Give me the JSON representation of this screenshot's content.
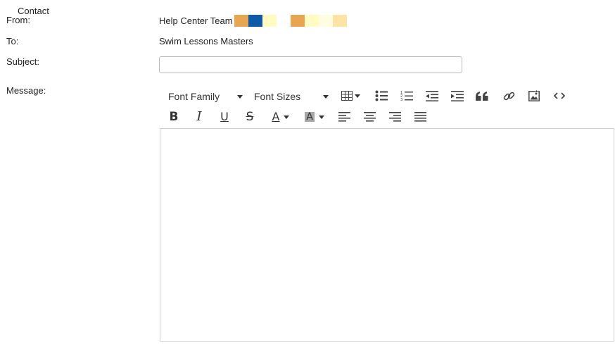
{
  "form": {
    "contact_label": "Contact",
    "from_label": "From:",
    "from_value": "Help Center Team",
    "from_swatches": [
      "#E8A552",
      "#0D5AA8",
      "#FFFBC2",
      "#FFFFFF",
      "#E8A552",
      "#FFFBC2",
      "#FFFDE0",
      "#FDE3A4"
    ],
    "to_label": "To:",
    "to_value": "Swim Lessons Masters",
    "subject_label": "Subject:",
    "subject_value": "",
    "message_label": "Message:",
    "message_value": ""
  },
  "toolbar": {
    "font_family": "Font Family",
    "font_sizes": "Font Sizes",
    "icons": {
      "table": "table-icon",
      "bullet_list": "bullet-list-icon",
      "numbered_list": "numbered-list-icon",
      "outdent": "outdent-icon",
      "indent": "indent-icon",
      "blockquote": "quote-icon",
      "link": "link-icon",
      "image": "image-icon",
      "code": "code-icon",
      "bold": "bold-icon",
      "italic": "italic-icon",
      "underline": "underline-icon",
      "strikethrough": "strikethrough-icon",
      "text_color": "text-color-icon",
      "background_color": "background-color-icon",
      "align_left": "align-left-icon",
      "align_center": "align-center-icon",
      "align_right": "align-right-icon",
      "justify": "justify-icon"
    },
    "glyphs": {
      "bold": "B",
      "italic": "I",
      "underline": "U",
      "strike": "S",
      "text_color": "A",
      "background_color": "A"
    }
  }
}
